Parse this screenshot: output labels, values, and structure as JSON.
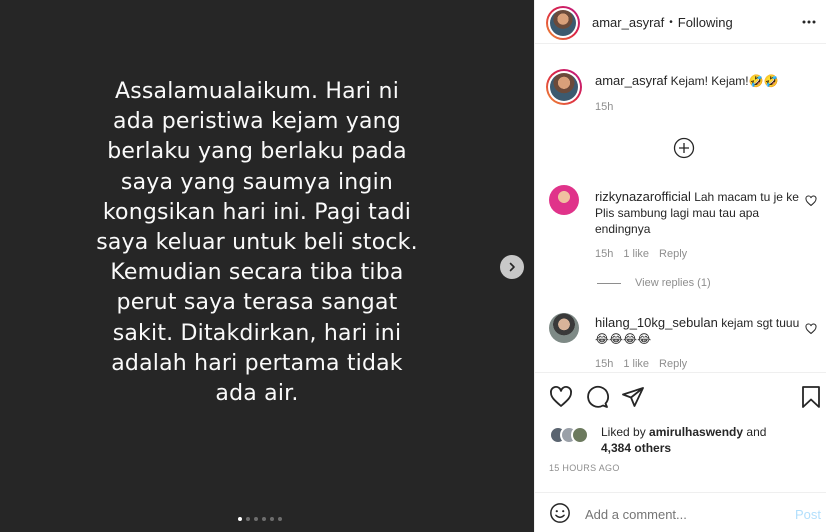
{
  "post": {
    "text": "Assalamualaikum. Hari ni ada peristiwa kejam yang berlaku yang berlaku pada saya yang saumya ingin kongsikan hari ini. Pagi tadi saya keluar untuk beli stock. Kemudian secara tiba tiba perut saya terasa sangat sakit. Ditakdirkan, hari ini adalah hari pertama tidak ada air.",
    "slide_count": 6,
    "active_slide": 1
  },
  "header": {
    "username": "amar_asyraf",
    "separator": "•",
    "follow_status": "Following"
  },
  "caption": {
    "username": "amar_asyraf",
    "text": "Kejam! Kejam!🤣🤣",
    "time": "15h"
  },
  "comments": [
    {
      "username": "rizkynazarofficial",
      "text": "Lah macam tu je ke Plis sambung lagi mau tau apa endingnya",
      "time": "15h",
      "likes": "1 like",
      "reply": "Reply",
      "view_replies": "View replies (1)"
    },
    {
      "username": "hilang_10kg_sebulan",
      "text": "kejam sgt tuuu 😂😂😂😂",
      "time": "15h",
      "likes": "1 like",
      "reply": "Reply"
    }
  ],
  "liked_by": {
    "prefix": "Liked by ",
    "username": "amirulhaswendy",
    "conj": " and",
    "others": "4,384 others"
  },
  "time_ago": "15 HOURS AGO",
  "comment_input": {
    "placeholder": "Add a comment...",
    "post_label": "Post"
  },
  "colors": {
    "media_bg": "#262626",
    "link_blue": "#0095f6",
    "muted": "#8e8e8e"
  }
}
